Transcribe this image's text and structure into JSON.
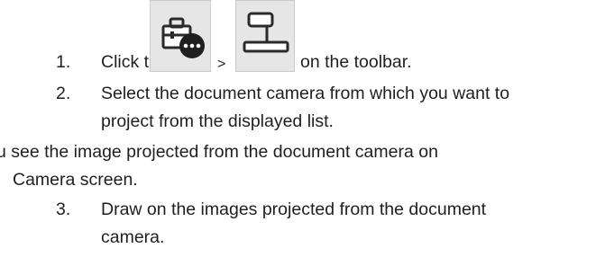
{
  "steps": [
    {
      "number": "1.",
      "text_before_icons": "Click the",
      "icon_1": "toolbox-more-icon",
      "separator": ">",
      "icon_2": "document-camera-icon",
      "text_after_icons": "on the toolbar."
    },
    {
      "number": "2.",
      "line_1": "Select the document camera from which you want to",
      "line_2": "project from the displayed list."
    }
  ],
  "note": {
    "line_1": "u see the image projected from the document camera on",
    "line_2": "Camera screen."
  },
  "step_3": {
    "number": "3.",
    "line_1": "Draw on the images projected from the document",
    "line_2": "camera."
  },
  "colors": {
    "text": "#1f1f1f",
    "icon_background": "#e6e6e6",
    "icon_border": "#c9c9c9"
  }
}
